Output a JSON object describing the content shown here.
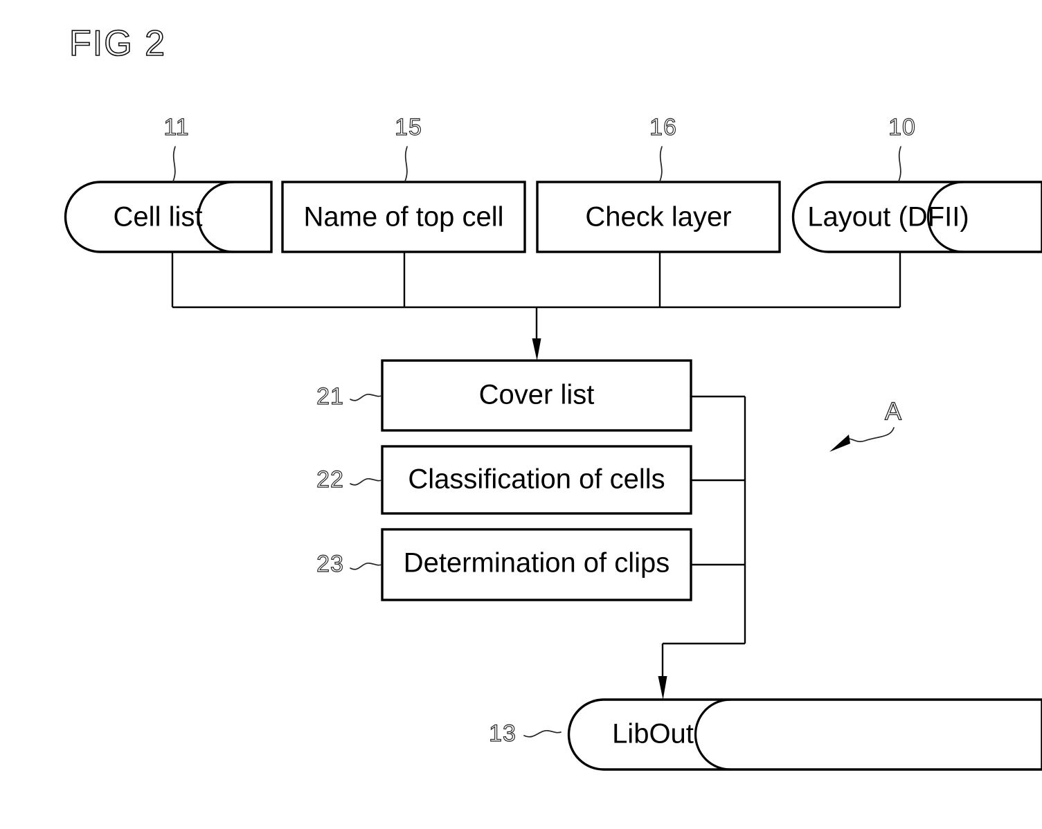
{
  "figure": {
    "title": "FIG 2",
    "annotation_letter": "A"
  },
  "inputs": {
    "items": [
      {
        "ref": "11",
        "label": "Cell list",
        "shape": "cylinder"
      },
      {
        "ref": "15",
        "label": "Name of top cell",
        "shape": "rectangle"
      },
      {
        "ref": "16",
        "label": "Check layer",
        "shape": "rectangle"
      },
      {
        "ref": "10",
        "label": "Layout (DFII)",
        "shape": "cylinder"
      }
    ]
  },
  "process": {
    "items": [
      {
        "ref": "21",
        "label": "Cover list",
        "shape": "rectangle"
      },
      {
        "ref": "22",
        "label": "Classification of cells",
        "shape": "rectangle"
      },
      {
        "ref": "23",
        "label": "Determination of clips",
        "shape": "rectangle"
      }
    ]
  },
  "output": {
    "items": [
      {
        "ref": "13",
        "label": "LibOut",
        "shape": "cylinder"
      }
    ]
  },
  "colors": {
    "background": "#ffffff",
    "stroke": "#000000",
    "text": "#000000",
    "leader": "#222222"
  }
}
